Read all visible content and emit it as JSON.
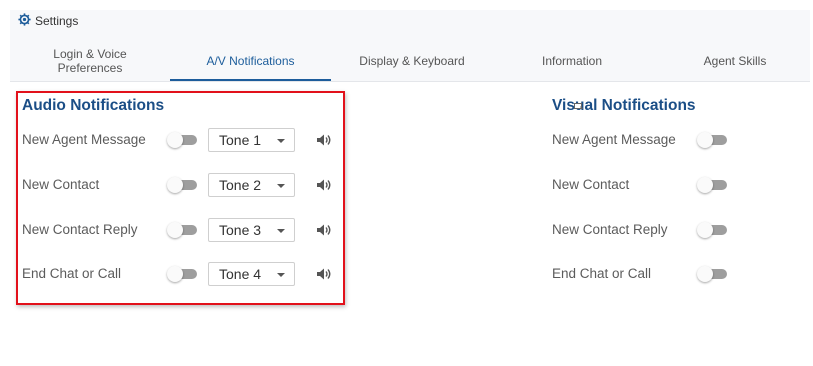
{
  "header": {
    "title": "Settings",
    "icon": "gear-icon"
  },
  "tabs": [
    {
      "label": "Login & Voice\nPreferences",
      "active": false
    },
    {
      "label": "A/V Notifications",
      "active": true
    },
    {
      "label": "Display & Keyboard",
      "active": false
    },
    {
      "label": "Information",
      "active": false
    },
    {
      "label": "Agent Skills",
      "active": false
    }
  ],
  "audio": {
    "title": "Audio Notifications",
    "rows": [
      {
        "label": "New Agent Message",
        "enabled": false,
        "tone": "Tone 1"
      },
      {
        "label": "New Contact",
        "enabled": false,
        "tone": "Tone 2"
      },
      {
        "label": "New Contact Reply",
        "enabled": false,
        "tone": "Tone 3"
      },
      {
        "label": "End Chat or Call",
        "enabled": false,
        "tone": "Tone 4"
      }
    ]
  },
  "visual": {
    "title": "Visual Notifications",
    "rows": [
      {
        "label": "New Agent Message",
        "enabled": false
      },
      {
        "label": "New Contact",
        "enabled": false
      },
      {
        "label": "New Contact Reply",
        "enabled": false
      },
      {
        "label": "End Chat or Call",
        "enabled": false
      }
    ]
  },
  "colors": {
    "accent": "#1d5d9b",
    "highlight": "#e2111b",
    "title": "#1b4e86"
  }
}
